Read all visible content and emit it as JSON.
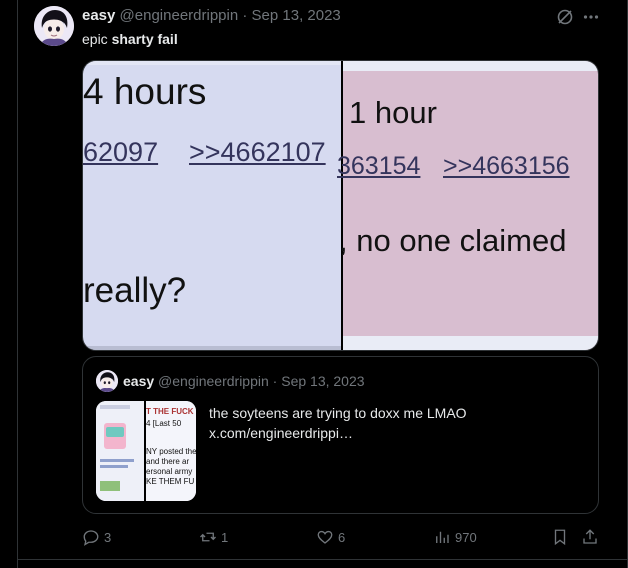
{
  "tweet": {
    "author_name": "easy",
    "handle": "@engineerdrippin",
    "separator": "·",
    "date": "Sep 13, 2023",
    "text_prefix": "epic ",
    "text_bold": "sharty fail",
    "media": {
      "left_panel": {
        "heading": "4 hours",
        "link_1": "62097",
        "link_2": ">>4662107",
        "body": "really?"
      },
      "right_panel": {
        "heading": "1 hour",
        "link_1": "363154",
        "link_2": ">>4663156",
        "body": ", no one claimed"
      }
    },
    "quote": {
      "author_name": "easy",
      "handle": "@engineerdrippin",
      "separator": "·",
      "date": "Sep 13, 2023",
      "text_line_1": "the soyteens are trying to doxx me LMAO",
      "text_line_2": "x.com/engineerdrippi…",
      "thumb_text": {
        "line_1": "T THE FUCK",
        "line_2": "4  [Last 50",
        "line_3": "NY posted the",
        "line_4": "and there ar",
        "line_5": "ersonal army",
        "line_6": "KE THEM FU"
      }
    },
    "actions": {
      "replies": "3",
      "reposts": "1",
      "likes": "6",
      "views": "970"
    }
  },
  "icons": {
    "grok": "grok-icon",
    "more": "more-icon",
    "reply": "reply-icon",
    "repost": "repost-icon",
    "like": "heart-icon",
    "views": "views-icon",
    "bookmark": "bookmark-icon",
    "share": "share-icon"
  },
  "colors": {
    "background": "#000000",
    "text": "#e7e9ea",
    "muted": "#71767b",
    "border": "#2f3336"
  }
}
